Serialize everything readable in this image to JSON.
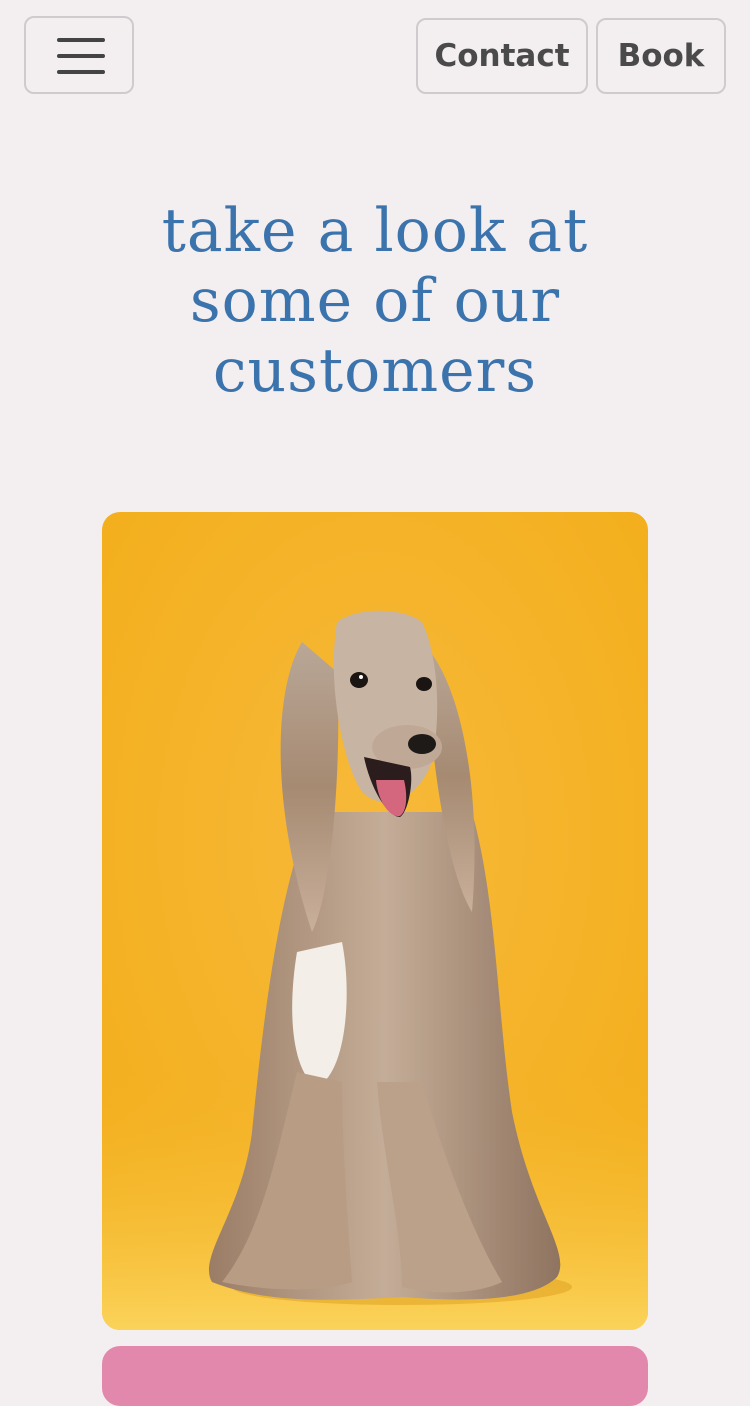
{
  "header": {
    "menu_icon": "hamburger-menu-icon",
    "contact_label": "Contact",
    "book_label": "Book"
  },
  "section": {
    "headline_lines": [
      "take a look at",
      "some of our",
      "customers"
    ]
  },
  "gallery": {
    "items": [
      {
        "subject": "long-haired dog on yellow background",
        "background_color": "#f5b42a"
      },
      {
        "subject": "partially visible card",
        "background_color": "#e288ad"
      }
    ]
  },
  "colors": {
    "page_background": "#f3eef0",
    "headline": "#3b73ad",
    "button_text": "#4a4a4a",
    "button_border": "#cfcacd"
  }
}
